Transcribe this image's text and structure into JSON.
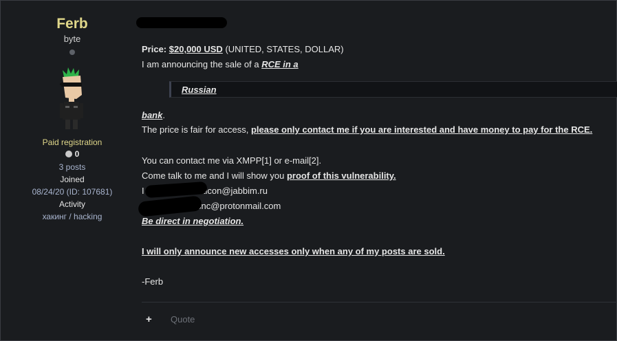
{
  "user": {
    "name": "Ferb",
    "title": "byte",
    "group": "Paid registration",
    "reputation": "0",
    "posts": "3 posts",
    "joined_label": "Joined",
    "joined_value": "08/24/20 (ID: 107681)",
    "activity_label": "Activity",
    "activity_value": "хакинг / hacking"
  },
  "post": {
    "price_label": "Price:",
    "price_value": "$20,000 USD",
    "price_note": " (UNITED, STATES, DOLLAR)",
    "l2_pre": "I am announcing the sale of a ",
    "l2_link": "RCE in a",
    "quote_text": "Russian ",
    "l3_link": "bank",
    "l3_post": ".",
    "l4_pre": "The price is fair for access, ",
    "l4_bold": "please only contact me if you are interested and have money to pay for the RCE.",
    "l5": "You can contact me via XMPP[1] or e-mail[2].",
    "l6_pre": "Come talk to me and I will show you ",
    "l6_bold": "proof of this vulnerability.",
    "l7_a": "I",
    "l7_b": "falcon@jabbim.ru",
    "l8": "snc@protonmail.com",
    "l9": "Be direct in negotiation.",
    "l10": "I will only announce new accesses only when any of my posts are sold.",
    "l11": "-Ferb"
  },
  "footer": {
    "plus": "+",
    "quote": "Quote"
  }
}
